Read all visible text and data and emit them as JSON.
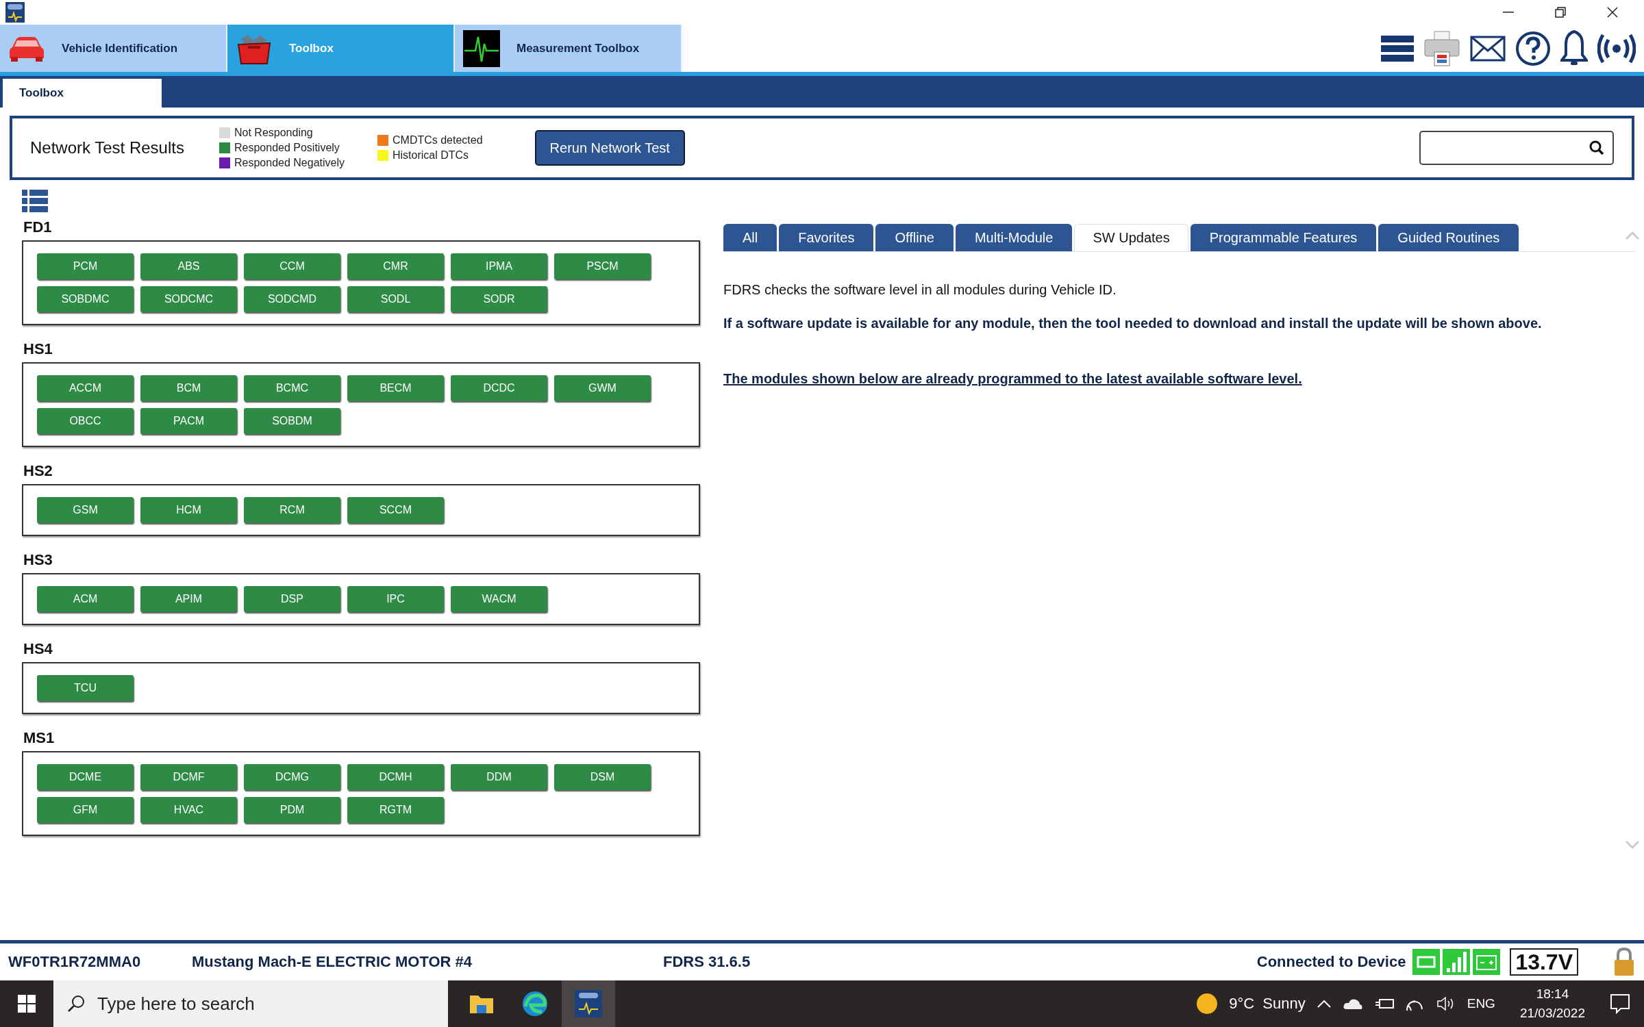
{
  "app_tabs": [
    {
      "label": "Vehicle Identification",
      "kind": "car",
      "selected": false
    },
    {
      "label": "Toolbox",
      "kind": "toolbox",
      "selected": true
    },
    {
      "label": "Measurement Toolbox",
      "kind": "scope",
      "selected": false
    }
  ],
  "sub_tabs": [
    {
      "label": "Toolbox",
      "selected": true
    }
  ],
  "network_test": {
    "title": "Network Test Results",
    "legend": [
      {
        "label": "Not Responding",
        "color": "#d9d9d9"
      },
      {
        "label": "Responded Positively",
        "color": "#2e8b45"
      },
      {
        "label": "Responded Negatively",
        "color": "#6a1bb0"
      },
      {
        "label": "CMDTCs detected",
        "color": "#f07818"
      },
      {
        "label": "Historical DTCs",
        "color": "#f8f520"
      }
    ],
    "rerun_button": "Rerun Network Test"
  },
  "networks": [
    {
      "name": "FD1",
      "modules": [
        {
          "label": "PCM",
          "color": "#2e8b45"
        },
        {
          "label": "ABS",
          "color": "#2e8b45"
        },
        {
          "label": "CCM",
          "color": "#2e8b45"
        },
        {
          "label": "CMR",
          "color": "#2e8b45"
        },
        {
          "label": "IPMA",
          "color": "#2e8b45"
        },
        {
          "label": "PSCM",
          "color": "#2e8b45"
        },
        {
          "label": "SOBDMC",
          "color": "#2e8b45"
        },
        {
          "label": "SODCMC",
          "color": "#2e8b45"
        },
        {
          "label": "SODCMD",
          "color": "#2e8b45"
        },
        {
          "label": "SODL",
          "color": "#2e8b45"
        },
        {
          "label": "SODR",
          "color": "#2e8b45"
        }
      ]
    },
    {
      "name": "HS1",
      "modules": [
        {
          "label": "ACCM",
          "color": "#2e8b45"
        },
        {
          "label": "BCM",
          "color": "#2e8b45"
        },
        {
          "label": "BCMC",
          "color": "#2e8b45"
        },
        {
          "label": "BECM",
          "color": "#2e8b45"
        },
        {
          "label": "DCDC",
          "color": "#2e8b45"
        },
        {
          "label": "GWM",
          "color": "#2e8b45"
        },
        {
          "label": "OBCC",
          "color": "#2e8b45"
        },
        {
          "label": "PACM",
          "color": "#2e8b45"
        },
        {
          "label": "SOBDM",
          "color": "#2e8b45"
        }
      ]
    },
    {
      "name": "HS2",
      "modules": [
        {
          "label": "GSM",
          "color": "#2e8b45"
        },
        {
          "label": "HCM",
          "color": "#2e8b45"
        },
        {
          "label": "RCM",
          "color": "#2e8b45"
        },
        {
          "label": "SCCM",
          "color": "#2e8b45"
        }
      ]
    },
    {
      "name": "HS3",
      "modules": [
        {
          "label": "ACM",
          "color": "#2e8b45"
        },
        {
          "label": "APIM",
          "color": "#2e8b45"
        },
        {
          "label": "DSP",
          "color": "#2e8b45"
        },
        {
          "label": "IPC",
          "color": "#2e8b45"
        },
        {
          "label": "WACM",
          "color": "#2e8b45"
        }
      ]
    },
    {
      "name": "HS4",
      "modules": [
        {
          "label": "TCU",
          "color": "#2e8b45"
        }
      ]
    },
    {
      "name": "MS1",
      "modules": [
        {
          "label": "DCME",
          "color": "#2e8b45"
        },
        {
          "label": "DCMF",
          "color": "#2e8b45"
        },
        {
          "label": "DCMG",
          "color": "#2e8b45"
        },
        {
          "label": "DCMH",
          "color": "#2e8b45"
        },
        {
          "label": "DDM",
          "color": "#2e8b45"
        },
        {
          "label": "DSM",
          "color": "#2e8b45"
        },
        {
          "label": "GFM",
          "color": "#2e8b45"
        },
        {
          "label": "HVAC",
          "color": "#2e8b45"
        },
        {
          "label": "PDM",
          "color": "#2e8b45"
        },
        {
          "label": "RGTM",
          "color": "#2e8b45"
        }
      ]
    }
  ],
  "tool_tabs": [
    {
      "label": "All",
      "selected": false
    },
    {
      "label": "Favorites",
      "selected": false
    },
    {
      "label": "Offline",
      "selected": false
    },
    {
      "label": "Multi-Module",
      "selected": false
    },
    {
      "label": "SW Updates",
      "selected": true
    },
    {
      "label": "Programmable Features",
      "selected": false
    },
    {
      "label": "Guided Routines",
      "selected": false
    }
  ],
  "sw_updates": {
    "intro": "FDRS checks the software level in all modules during Vehicle ID.",
    "notice": "If a software update is available for any module, then the tool needed to download and install the update will be shown above.",
    "latest_link": "The modules shown below are already programmed to the latest available software level."
  },
  "status_bar": {
    "vin": "WF0TR1R72MMA0",
    "vehicle": "Mustang Mach-E ELECTRIC MOTOR #4",
    "version": "FDRS 31.6.5",
    "connection": "Connected to Device",
    "voltage": "13.7V"
  },
  "taskbar": {
    "search_placeholder": "Type here to search",
    "weather": "9°C  Sunny",
    "language": "ENG",
    "time": "18:14",
    "date": "21/03/2022"
  }
}
